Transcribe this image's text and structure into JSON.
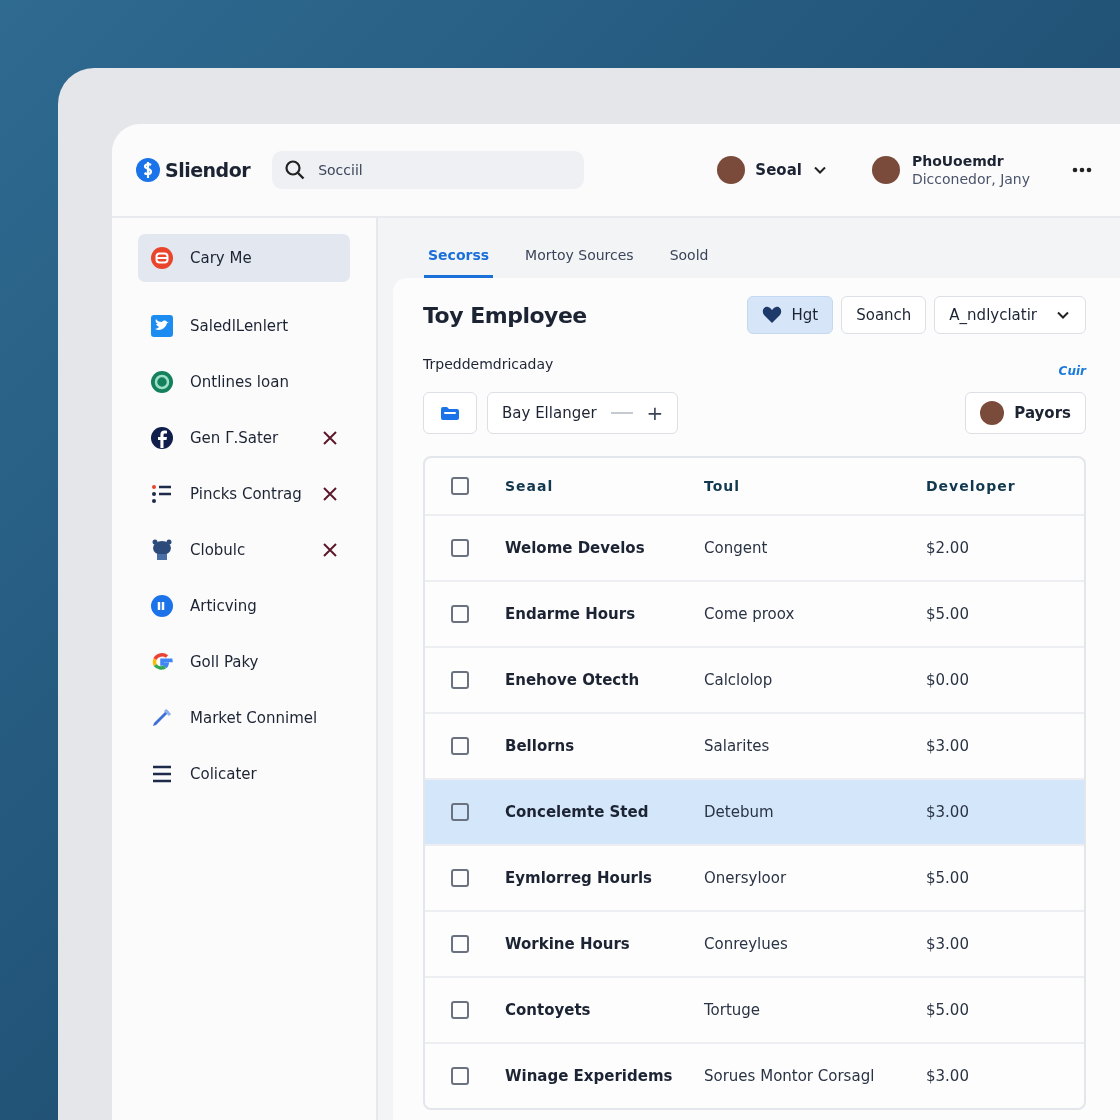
{
  "header": {
    "logo": "Sliendor",
    "search": {
      "placeholder": "Socciil"
    },
    "account_menu": {
      "label": "Seoal"
    },
    "profile": {
      "name": "PhoUoemdr",
      "subtitle": "Dicconedor, Jany"
    }
  },
  "sidebar": {
    "items": [
      {
        "label": "Cary Me",
        "selected": true,
        "removable": false
      },
      {
        "label": "SaledlLenlert",
        "selected": false,
        "removable": false
      },
      {
        "label": "Ontlines loan",
        "selected": false,
        "removable": false
      },
      {
        "label": "Gen Γ.Sater",
        "selected": false,
        "removable": true
      },
      {
        "label": "Pincks Contrag",
        "selected": false,
        "removable": true
      },
      {
        "label": "Clobulc",
        "selected": false,
        "removable": true
      },
      {
        "label": "Articving",
        "selected": false,
        "removable": false
      },
      {
        "label": "Goll Paky",
        "selected": false,
        "removable": false
      },
      {
        "label": "Market Connimel",
        "selected": false,
        "removable": false
      },
      {
        "label": "Colicater",
        "selected": false,
        "removable": false
      }
    ]
  },
  "tabs": [
    {
      "label": "Secorss",
      "selected": true
    },
    {
      "label": "Mortoy Sources",
      "selected": false
    },
    {
      "label": "Soold",
      "selected": false
    }
  ],
  "panel": {
    "title": "Toy Employee",
    "buttons": [
      {
        "label": "Hgt",
        "selected": true
      },
      {
        "label": "Soanch",
        "selected": false
      }
    ],
    "dropdown": "A_ndlyclatir",
    "subtitle": "Trpeddemdricaday",
    "link": "Cuir",
    "filter": {
      "label": "Bay Ellanger",
      "add": "+"
    },
    "payors": "Payors"
  },
  "table": {
    "all_checked": false,
    "columns": [
      "Seaal",
      "Toul",
      "Developer"
    ],
    "rows": [
      {
        "cells": [
          "Welome Develos",
          "Congent",
          "$2.00"
        ],
        "checked": false,
        "selected": false
      },
      {
        "cells": [
          "Endarme Hours",
          "Come proox",
          "$5.00"
        ],
        "checked": false,
        "selected": false
      },
      {
        "cells": [
          "Enehove Otecth",
          "Calclolop",
          "$0.00"
        ],
        "checked": false,
        "selected": false
      },
      {
        "cells": [
          "Bellorns",
          "Salarites",
          "$3.00"
        ],
        "checked": false,
        "selected": false
      },
      {
        "cells": [
          "Concelemte Sted",
          "Detebum",
          "$3.00"
        ],
        "checked": false,
        "selected": true
      },
      {
        "cells": [
          "Eymlorreg Hourls",
          "Onersyloor",
          "$5.00"
        ],
        "checked": false,
        "selected": false
      },
      {
        "cells": [
          "Workine Hours",
          "Conreylues",
          "$3.00"
        ],
        "checked": false,
        "selected": false
      },
      {
        "cells": [
          "Contoyets",
          "Tortuge",
          "$5.00"
        ],
        "checked": false,
        "selected": false
      },
      {
        "cells": [
          "Winage Experidems",
          "Sorues Montor Corsagl",
          "$3.00"
        ],
        "checked": false,
        "selected": false
      }
    ]
  }
}
